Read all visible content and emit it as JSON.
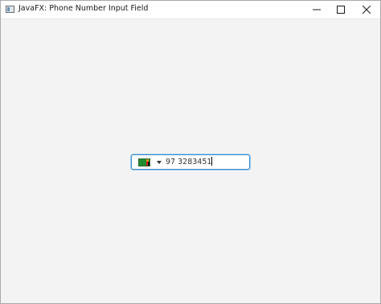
{
  "window": {
    "title": "JavaFX: Phone Number Input Field"
  },
  "controls": {
    "minimize_icon": "minimize-icon",
    "maximize_icon": "maximize-icon",
    "close_icon": "close-icon"
  },
  "phone_field": {
    "country_flag": "zambia-flag-icon",
    "value": "97 3283451",
    "focus_color": "#3b8fd1"
  }
}
